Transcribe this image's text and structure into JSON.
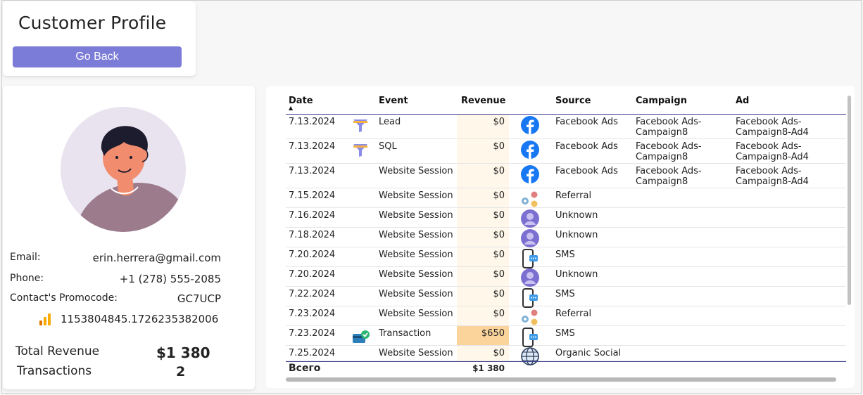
{
  "header": {
    "title": "Customer Profile",
    "back_label": "Go Back"
  },
  "profile": {
    "email_label": "Email:",
    "email": "erin.herrera@gmail.com",
    "phone_label": "Phone:",
    "phone": "+1 (278) 555-2085",
    "promo_label": "Contact's Promocode:",
    "promo": "GC7UCP",
    "client_id": "1153804845.1726235382006",
    "total_revenue_label": "Total Revenue",
    "total_revenue": "$1 380",
    "transactions_label": "Transactions",
    "transactions": "2"
  },
  "table": {
    "columns": {
      "date": "Date",
      "event": "Event",
      "revenue": "Revenue",
      "source": "Source",
      "campaign": "Campaign",
      "ad": "Ad"
    },
    "rows": [
      {
        "date": "7.13.2024",
        "event_icon": "funnel-icon",
        "event": "Lead",
        "revenue": "$0",
        "source_icon": "facebook-icon",
        "source": "Facebook Ads",
        "campaign": [
          "Facebook Ads-",
          "Campaign8"
        ],
        "ad": [
          "Facebook Ads-",
          "Campaign8-Ad4"
        ]
      },
      {
        "date": "7.13.2024",
        "event_icon": "funnel-icon",
        "event": "SQL",
        "revenue": "$0",
        "source_icon": "facebook-icon",
        "source": "Facebook Ads",
        "campaign": [
          "Facebook Ads-",
          "Campaign8"
        ],
        "ad": [
          "Facebook Ads-",
          "Campaign8-Ad4"
        ]
      },
      {
        "date": "7.13.2024",
        "event_icon": "",
        "event": "Website Session",
        "revenue": "$0",
        "source_icon": "facebook-icon",
        "source": "Facebook Ads",
        "campaign": [
          "Facebook Ads-",
          "Campaign8"
        ],
        "ad": [
          "Facebook Ads-",
          "Campaign8-Ad4"
        ]
      },
      {
        "date": "7.15.2024",
        "event_icon": "",
        "event": "Website Session",
        "revenue": "$0",
        "source_icon": "referral-icon",
        "source": "Referral",
        "campaign": [
          "",
          ""
        ],
        "ad": [
          "",
          ""
        ]
      },
      {
        "date": "7.16.2024",
        "event_icon": "",
        "event": "Website Session",
        "revenue": "$0",
        "source_icon": "unknown-user-icon",
        "source": "Unknown",
        "campaign": [
          "",
          ""
        ],
        "ad": [
          "",
          ""
        ]
      },
      {
        "date": "7.18.2024",
        "event_icon": "",
        "event": "Website Session",
        "revenue": "$0",
        "source_icon": "unknown-user-icon",
        "source": "Unknown",
        "campaign": [
          "",
          ""
        ],
        "ad": [
          "",
          ""
        ]
      },
      {
        "date": "7.20.2024",
        "event_icon": "",
        "event": "Website Session",
        "revenue": "$0",
        "source_icon": "sms-phone-icon",
        "source": "SMS",
        "campaign": [
          "",
          ""
        ],
        "ad": [
          "",
          ""
        ]
      },
      {
        "date": "7.20.2024",
        "event_icon": "",
        "event": "Website Session",
        "revenue": "$0",
        "source_icon": "unknown-user-icon",
        "source": "Unknown",
        "campaign": [
          "",
          ""
        ],
        "ad": [
          "",
          ""
        ]
      },
      {
        "date": "7.22.2024",
        "event_icon": "",
        "event": "Website Session",
        "revenue": "$0",
        "source_icon": "sms-phone-icon",
        "source": "SMS",
        "campaign": [
          "",
          ""
        ],
        "ad": [
          "",
          ""
        ]
      },
      {
        "date": "7.23.2024",
        "event_icon": "",
        "event": "Website Session",
        "revenue": "$0",
        "source_icon": "referral-icon",
        "source": "Referral",
        "campaign": [
          "",
          ""
        ],
        "ad": [
          "",
          ""
        ]
      },
      {
        "date": "7.23.2024",
        "event_icon": "card-check-icon",
        "event": "Transaction",
        "revenue": "$650",
        "source_icon": "sms-phone-icon",
        "source": "SMS",
        "campaign": [
          "",
          ""
        ],
        "ad": [
          "",
          ""
        ]
      },
      {
        "date": "7.25.2024",
        "event_icon": "",
        "event": "Website Session",
        "revenue": "$0",
        "source_icon": "globe-icon",
        "source": "Organic Social",
        "campaign": [
          "",
          ""
        ],
        "ad": [
          "",
          ""
        ]
      }
    ],
    "total_label": "Всего",
    "total_revenue": "$1 380"
  },
  "colors": {
    "accent": "#7b7bd8",
    "revenue_highlight": "#fbd49b",
    "revenue_column": "#fff7ea",
    "header_line": "#3b3b8f"
  }
}
